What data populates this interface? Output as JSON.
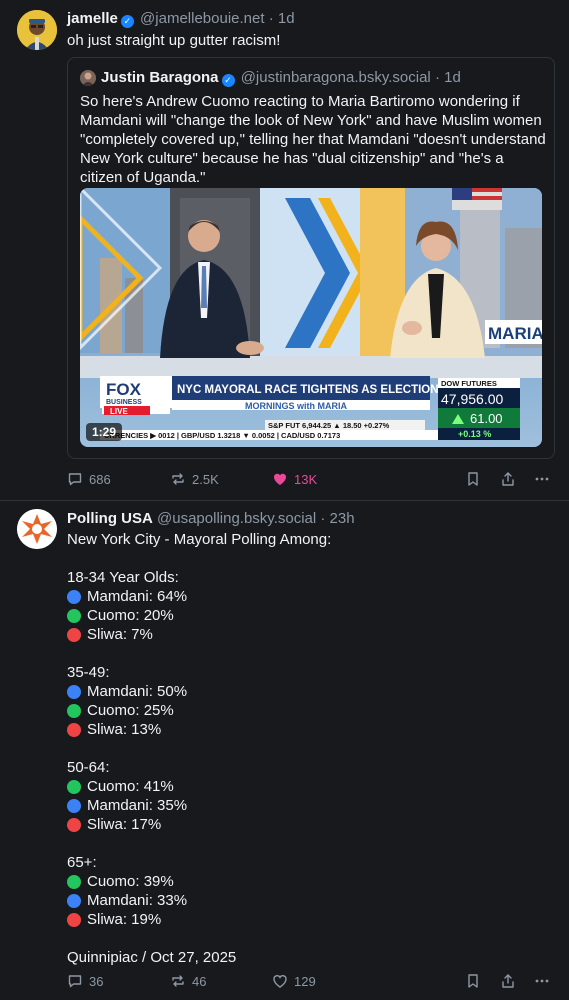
{
  "post1": {
    "display_name": "jamelle",
    "handle": "@jamellebouie.net",
    "time": "· 1d",
    "text": "oh just straight up gutter racism!",
    "quote": {
      "display_name": "Justin Baragona",
      "handle": "@justinbaragona.bsky.social",
      "time": "· 1d",
      "text": "So here's Andrew Cuomo reacting to Maria Bartiromo wondering if Mamdani will \"change the look of New York\" and have Muslim women \"completely covered up,\" telling her that Mamdani \"doesn't understand New York culture\" because he has \"dual citizenship\" and \"he's a citizen of Uganda.\"",
      "video": {
        "duration": "1:29",
        "chyron": "NYC MAYORAL RACE TIGHTENS AS ELECTION DAY NEARS",
        "network": "FOX",
        "network_sub": "BUSINESS",
        "live": "LIVE",
        "show": "MORNINGS with MARIA",
        "wall_text": "MARIA",
        "dow_label": "DOW FUTURES",
        "dow_value": "47,956.00",
        "dow_change": "61.00",
        "dow_pct": "+0.13 %",
        "ticker": "URRENCIES ▶ 0012 | GBP/USD 1.3218 ▼ 0.0052 | CAD/USD 0.7173",
        "spfut": "S&P FUT  6,944.25  ▲ 18.50  +0.27%"
      }
    },
    "actions": {
      "replies": "686",
      "reposts": "2.5K",
      "likes": "13K"
    }
  },
  "post2": {
    "display_name": "Polling USA",
    "handle": "@usapolling.bsky.social",
    "time": "· 23h",
    "intro": "New York City - Mayoral Polling Among:",
    "groups": [
      {
        "label": "18-34 Year Olds:",
        "rows": [
          {
            "color": "blue",
            "text": "Mamdani: 64%"
          },
          {
            "color": "green",
            "text": "Cuomo: 20%"
          },
          {
            "color": "red",
            "text": "Sliwa: 7%"
          }
        ]
      },
      {
        "label": "35-49:",
        "rows": [
          {
            "color": "blue",
            "text": "Mamdani: 50%"
          },
          {
            "color": "green",
            "text": "Cuomo: 25%"
          },
          {
            "color": "red",
            "text": "Sliwa: 13%"
          }
        ]
      },
      {
        "label": "50-64:",
        "rows": [
          {
            "color": "green",
            "text": "Cuomo: 41%"
          },
          {
            "color": "blue",
            "text": "Mamdani: 35%"
          },
          {
            "color": "red",
            "text": "Sliwa: 17%"
          }
        ]
      },
      {
        "label": "65+:",
        "rows": [
          {
            "color": "green",
            "text": "Cuomo: 39%"
          },
          {
            "color": "blue",
            "text": "Mamdani: 33%"
          },
          {
            "color": "red",
            "text": "Sliwa: 19%"
          }
        ]
      }
    ],
    "source": "Quinnipiac / Oct 27, 2025",
    "actions": {
      "replies": "36",
      "reposts": "46",
      "likes": "129"
    }
  },
  "colors": {
    "blue": "#3b82f6",
    "green": "#22c55e",
    "red": "#ef4444",
    "like": "#ec4899",
    "verified": "#1a85ff"
  }
}
